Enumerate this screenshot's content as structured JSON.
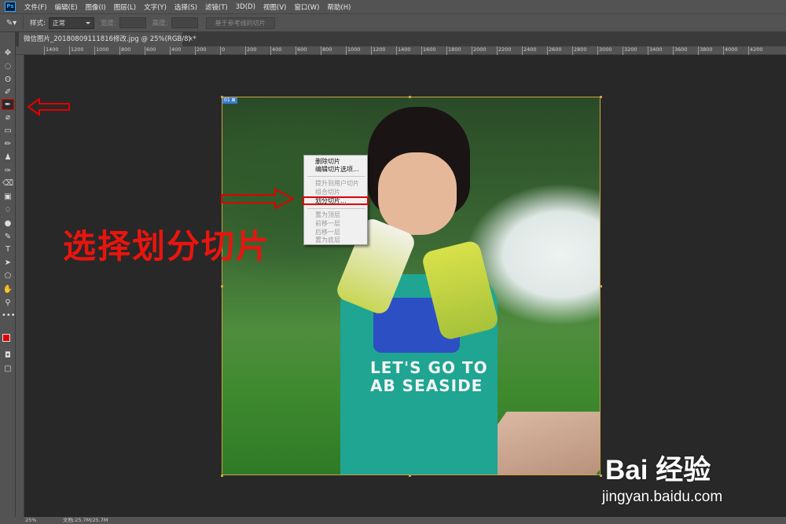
{
  "app": {
    "logo_text": "Ps"
  },
  "menu": [
    "文件(F)",
    "编辑(E)",
    "图像(I)",
    "图层(L)",
    "文字(Y)",
    "选择(S)",
    "滤镜(T)",
    "3D(D)",
    "视图(V)",
    "窗口(W)",
    "帮助(H)"
  ],
  "options": {
    "style_label": "样式:",
    "style_value": "正常",
    "width_label": "宽度:",
    "height_label": "高度:",
    "guides_button": "基于参考线的切片"
  },
  "document": {
    "tab_title": "微信图片_20180809111816修改.jpg @ 25%(RGB/8) *",
    "close_glyph": "×"
  },
  "ruler": {
    "h_ticks": [
      "1400",
      "1200",
      "1000",
      "800",
      "600",
      "400",
      "200",
      "0",
      "200",
      "400",
      "600",
      "800",
      "1000",
      "1200",
      "1400",
      "1600",
      "1800",
      "2000",
      "2200",
      "2400",
      "2600",
      "2800",
      "3000",
      "3200",
      "3400",
      "3600",
      "3800",
      "4000",
      "4200"
    ]
  },
  "canvas": {
    "slice_badge": "01 ⊠",
    "shirt_line1": "LET'S GO TO",
    "shirt_line2": "AB SEASIDE"
  },
  "context_menu": {
    "items": [
      {
        "label": "删除切片",
        "enabled": true
      },
      {
        "label": "编辑切片选项...",
        "enabled": true
      },
      {
        "label": "提升到用户切片",
        "enabled": false
      },
      {
        "label": "组合切片",
        "enabled": false
      },
      {
        "label": "划分切片...",
        "enabled": true,
        "highlighted": true
      },
      {
        "label": "置为顶层",
        "enabled": false
      },
      {
        "label": "前移一层",
        "enabled": false
      },
      {
        "label": "后移一层",
        "enabled": false
      },
      {
        "label": "置为底层",
        "enabled": false
      }
    ]
  },
  "annotation": {
    "text": "选择划分切片",
    "color": "#e8150e"
  },
  "watermark": {
    "brand": "Bai 经验",
    "url": "jingyan.baidu.com"
  },
  "status": {
    "zoom": "25%",
    "doc_info": "文档:25.7M/25.7M"
  },
  "colors": {
    "foreground": "#e00000",
    "background": "#ffffff",
    "highlight_box": "#e00000"
  }
}
